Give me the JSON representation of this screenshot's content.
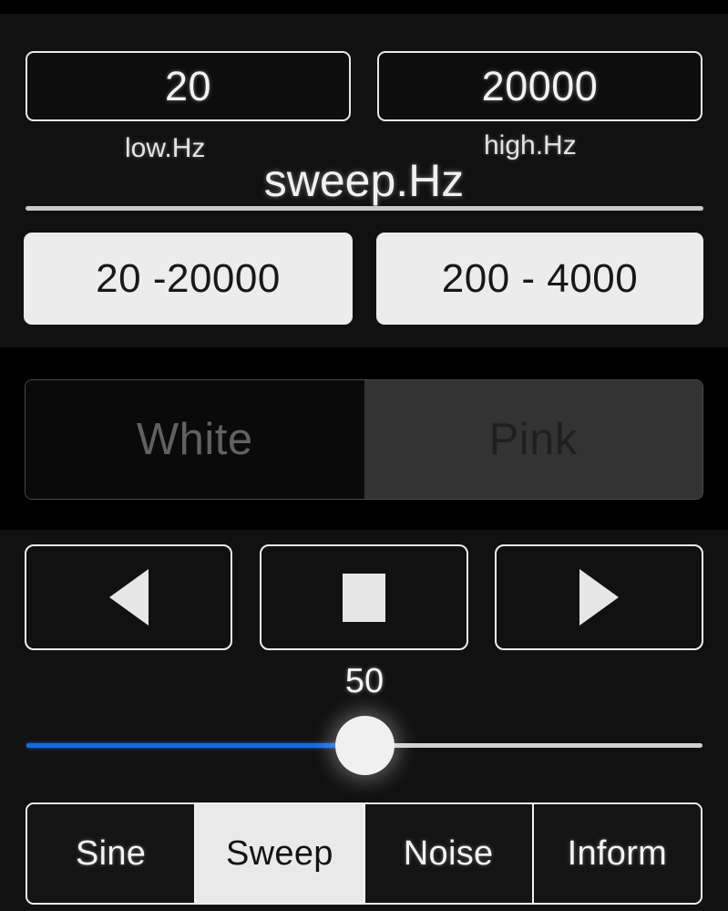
{
  "screen": {
    "title": "sweep.Hz",
    "background_color": "#111111",
    "accent_color": "#1668e3"
  },
  "frequency": {
    "low": {
      "value": "20",
      "label": "low.Hz"
    },
    "high": {
      "value": "20000",
      "label": "high.Hz"
    },
    "title": "sweep.Hz"
  },
  "presets": [
    {
      "label": "20 -20000"
    },
    {
      "label": "200 - 4000"
    }
  ],
  "noise_type": {
    "options": [
      {
        "label": "White",
        "selected": false
      },
      {
        "label": "Pink",
        "selected": true
      }
    ]
  },
  "transport": {
    "buttons": [
      {
        "name": "reverse",
        "icon": "triangle-left-icon"
      },
      {
        "name": "stop",
        "icon": "square-stop-icon"
      },
      {
        "name": "play",
        "icon": "triangle-right-icon"
      }
    ]
  },
  "slider": {
    "value": "50",
    "percent": 50,
    "min": 0,
    "max": 100,
    "fill_color": "#1668e3",
    "track_color": "#d0d0d0"
  },
  "tabs": [
    {
      "label": "Sine",
      "active": false
    },
    {
      "label": "Sweep",
      "active": true
    },
    {
      "label": "Noise",
      "active": false
    },
    {
      "label": "Inform",
      "active": false
    }
  ]
}
